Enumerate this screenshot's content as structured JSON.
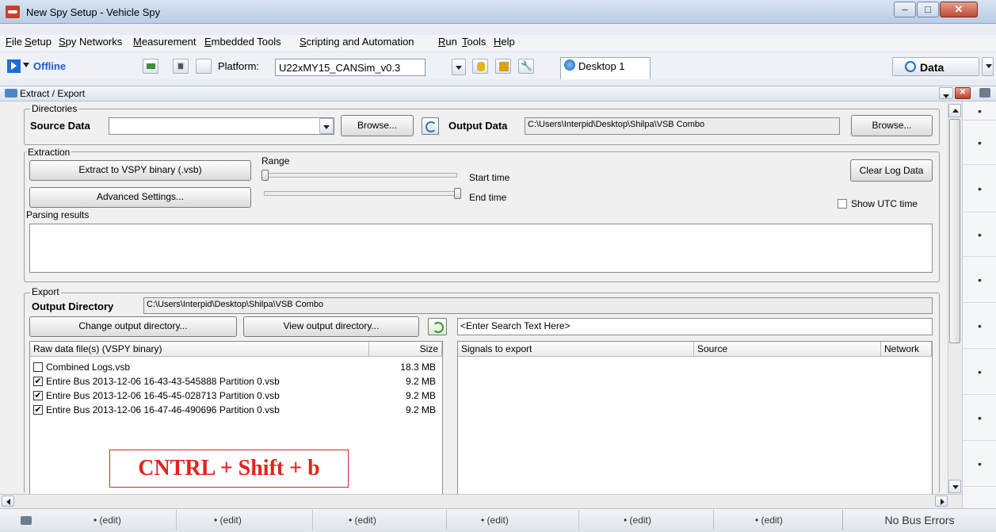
{
  "window": {
    "title": "New Spy Setup - Vehicle Spy"
  },
  "menu": [
    "File",
    "Setup",
    "Spy Networks",
    "Measurement",
    "Embedded Tools",
    "Scripting and Automation",
    "Run",
    "Tools",
    "Help"
  ],
  "toolbar": {
    "status": "Offline",
    "platform_label": "Platform:",
    "platform_value": "U22xMY15_CANSim_v0.3",
    "desktop_tab": "Desktop 1",
    "data_button": "Data"
  },
  "panel": {
    "title": "Extract / Export"
  },
  "directories": {
    "group_label": "Directories",
    "source_label": "Source Data",
    "source_value": "",
    "browse_label": "Browse...",
    "output_label": "Output Data",
    "output_value": "C:\\Users\\Interpid\\Desktop\\Shilpa\\VSB Combo"
  },
  "extraction": {
    "group_label": "Extraction",
    "extract_button": "Extract to VSPY binary (.vsb)",
    "advanced_button": "Advanced Settings...",
    "range_label": "Range",
    "start_label": "Start time",
    "end_label": "End time",
    "start_position": 0,
    "end_position": 1,
    "clear_log_button": "Clear Log Data",
    "utc_label": "Show UTC time",
    "parsing_label": "Parsing results"
  },
  "export": {
    "group_label": "Export",
    "output_dir_label": "Output Directory",
    "output_dir_value": "C:\\Users\\Interpid\\Desktop\\Shilpa\\VSB Combo",
    "change_dir_button": "Change output directory...",
    "view_dir_button": "View output directory...",
    "search_placeholder": "<Enter Search Text Here>",
    "files_columns": [
      "Raw data file(s) (VSPY binary)",
      "Size"
    ],
    "files": [
      {
        "name": "Combined Logs.vsb",
        "size": "18.3 MB",
        "checked": false
      },
      {
        "name": "Entire Bus 2013-12-06 16-43-43-545888 Partition 0.vsb",
        "size": "9.2 MB",
        "checked": true
      },
      {
        "name": "Entire Bus 2013-12-06 16-45-45-028713 Partition 0.vsb",
        "size": "9.2 MB",
        "checked": true
      },
      {
        "name": "Entire Bus 2013-12-06 16-47-46-490696 Partition 0.vsb",
        "size": "9.2 MB",
        "checked": true
      }
    ],
    "signals_columns": [
      "Signals to export",
      "Source",
      "Network"
    ]
  },
  "annotation": "CNTRL + Shift + b",
  "statusbar": {
    "cells": [
      "•  (edit)",
      "•  (edit)",
      "•  (edit)",
      "•  (edit)",
      "•  (edit)",
      "•  (edit)"
    ],
    "bus_errors": "No Bus Errors"
  },
  "right_column": [
    "•",
    "•",
    "•",
    "•",
    "•",
    "•",
    "•",
    "•",
    "•"
  ]
}
